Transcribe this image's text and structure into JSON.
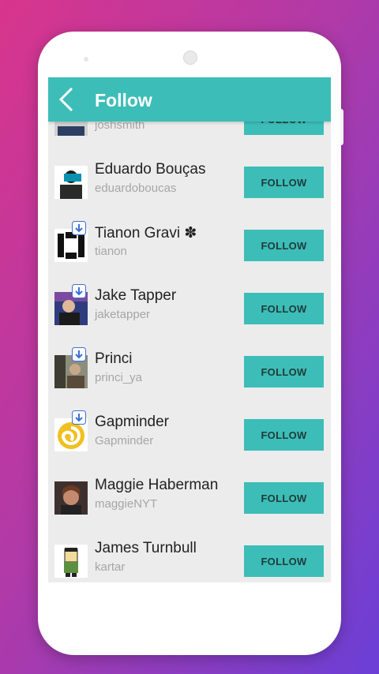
{
  "header": {
    "title": "Follow"
  },
  "follow_label": "FOLLOW",
  "colors": {
    "accent": "#3dbdb8",
    "background_gradient_start": "#d8358c",
    "background_gradient_end": "#6b3fd6"
  },
  "users": [
    {
      "name": "",
      "handle": "joshsmith",
      "button": "FOLLOW"
    },
    {
      "name": "Eduardo Bouças",
      "handle": "eduardoboucas",
      "button": "FOLLOW"
    },
    {
      "name": "Tianon Gravi ✽",
      "handle": "tianon",
      "button": "FOLLOW"
    },
    {
      "name": "Jake Tapper",
      "handle": "jaketapper",
      "button": "FOLLOW"
    },
    {
      "name": "Princi",
      "handle": "princi_ya",
      "button": "FOLLOW"
    },
    {
      "name": "Gapminder",
      "handle": "Gapminder",
      "button": "FOLLOW"
    },
    {
      "name": "Maggie Haberman",
      "handle": "maggieNYT",
      "button": "FOLLOW"
    },
    {
      "name": "James Turnbull",
      "handle": "kartar",
      "button": "FOLLOW"
    }
  ]
}
